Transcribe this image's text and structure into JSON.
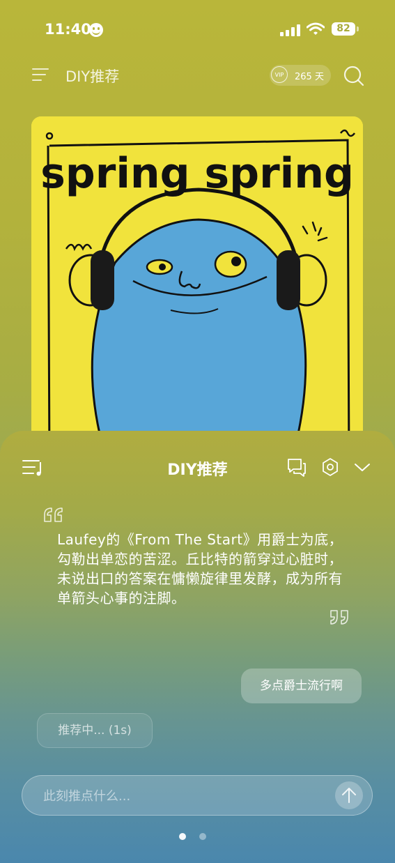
{
  "status_bar": {
    "time": "11:40",
    "battery": "82"
  },
  "header": {
    "title": "DIY推荐",
    "vip_badge": "VIP",
    "vip_days": "265 天"
  },
  "album": {
    "cover_text": "spring spring"
  },
  "sheet": {
    "title": "DIY推荐",
    "quote": "Laufey的《From The Start》用爵士为底，勾勒出单恋的苦涩。丘比特的箭穿过心脏时，未说出口的答案在慵懒旋律里发酵，成为所有单箭头心事的注脚。",
    "user_message": "多点爵士流行啊",
    "loading_message": "推荐中... (1s)",
    "input_placeholder": "此刻推点什么..."
  },
  "pager": {
    "active_index": 0,
    "count": 2
  },
  "colors": {
    "album_yellow": "#f1e33c",
    "creature_blue": "#58a6d8"
  }
}
